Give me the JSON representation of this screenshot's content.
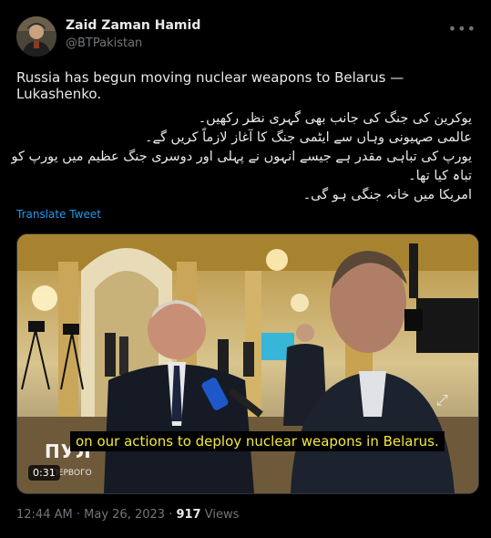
{
  "author": {
    "name": "Zaid Zaman Hamid",
    "handle": "@BTPakistan"
  },
  "icons": {
    "more": "more-options-icon",
    "expand": "fullscreen-icon"
  },
  "tweet": {
    "text_en": "Russia has begun moving nuclear weapons to Belarus — Lukashenko.",
    "text_ur": [
      "یوکرین کی جنگ کی جانب بھی گہری نظر رکھیں۔",
      "عالمی صہیونی وہاں سے ایٹمی جنگ کا آغاز لازماً کریں گے۔",
      "یورپ کی تباہی مقدر ہے جیسے انہوں نے پہلی اور دوسری جنگ عظیم میں یورپ کو",
      "تباہ کیا تھا۔",
      "امریکا میں خانہ جنگی ہو گی۔"
    ],
    "translate_label": "Translate Tweet"
  },
  "media": {
    "subtitle": "on our actions to deploy nuclear weapons in Belarus.",
    "watermark": "ПУЛ",
    "watermark_sub": "ПЕРВОГО",
    "duration": "0:31"
  },
  "meta": {
    "time": "12:44 AM",
    "separator": "·",
    "date": "May 26, 2023",
    "views": "917",
    "views_label": "Views"
  }
}
